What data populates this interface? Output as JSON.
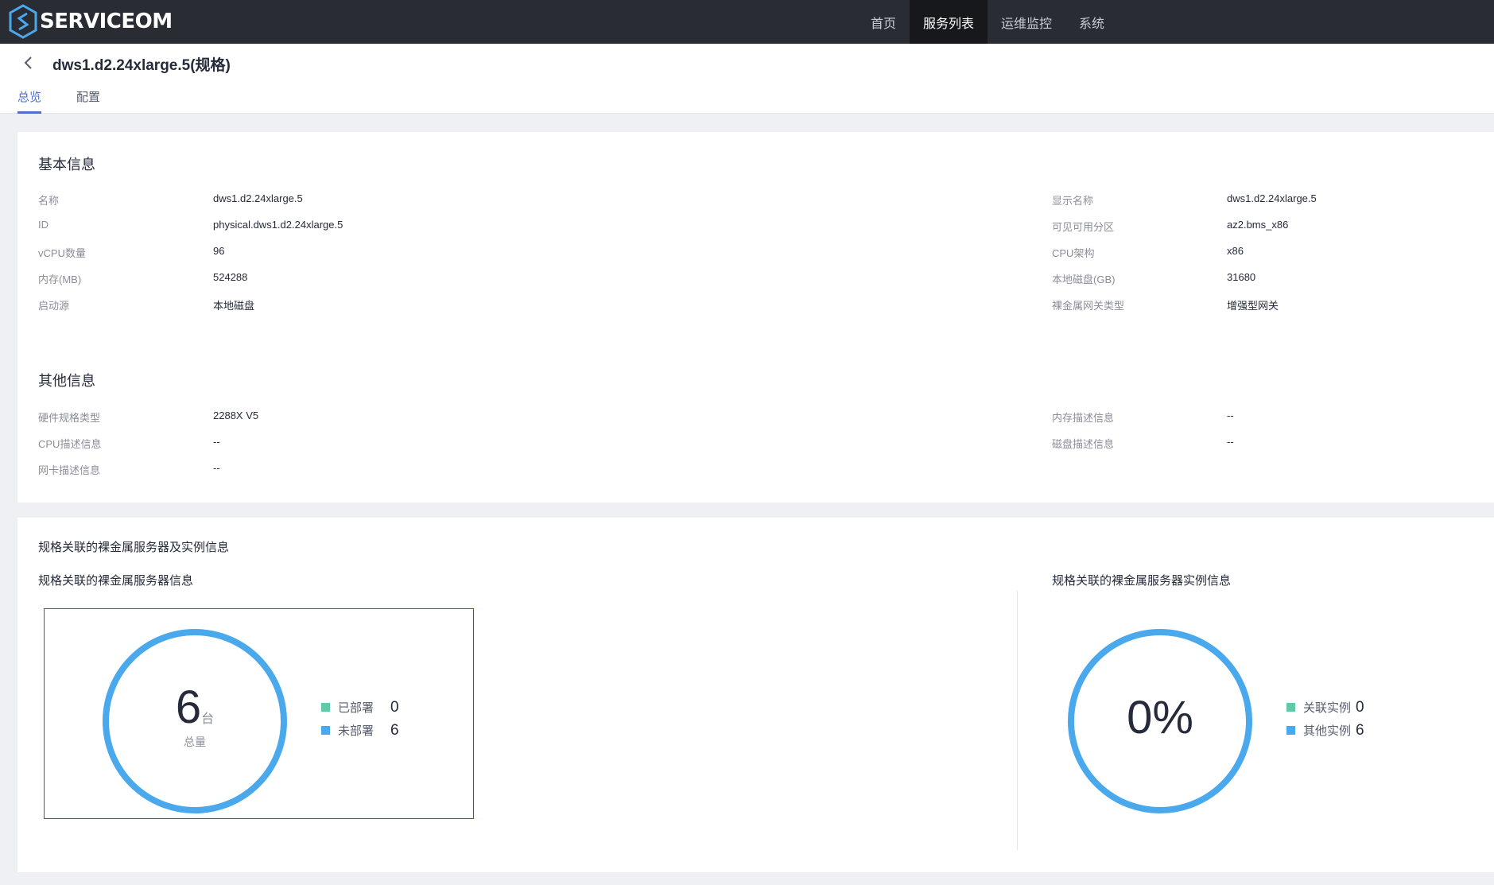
{
  "nav": {
    "logo_text": "SERVICEOM",
    "items": [
      {
        "label": "首页",
        "active": false
      },
      {
        "label": "服务列表",
        "active": true
      },
      {
        "label": "运维监控",
        "active": false
      },
      {
        "label": "系统",
        "active": false
      }
    ]
  },
  "header": {
    "title": "dws1.d2.24xlarge.5(规格)",
    "tabs": [
      {
        "label": "总览",
        "active": true
      },
      {
        "label": "配置",
        "active": false
      }
    ]
  },
  "basic_info": {
    "title": "基本信息",
    "left": [
      {
        "label": "名称",
        "value": "dws1.d2.24xlarge.5"
      },
      {
        "label": "ID",
        "value": "physical.dws1.d2.24xlarge.5"
      },
      {
        "label": "vCPU数量",
        "value": "96"
      },
      {
        "label": "内存(MB)",
        "value": "524288"
      },
      {
        "label": "启动源",
        "value": "本地磁盘"
      }
    ],
    "right": [
      {
        "label": "显示名称",
        "value": "dws1.d2.24xlarge.5"
      },
      {
        "label": "可见可用分区",
        "value": "az2.bms_x86"
      },
      {
        "label": "CPU架构",
        "value": "x86"
      },
      {
        "label": "本地磁盘(GB)",
        "value": "31680"
      },
      {
        "label": "裸金属网关类型",
        "value": "增强型网关"
      }
    ]
  },
  "other_info": {
    "title": "其他信息",
    "left": [
      {
        "label": "硬件规格类型",
        "value": "2288X V5"
      },
      {
        "label": "CPU描述信息",
        "value": "--"
      },
      {
        "label": "网卡描述信息",
        "value": "--"
      }
    ],
    "right": [
      {
        "label": "内存描述信息",
        "value": "--"
      },
      {
        "label": "磁盘描述信息",
        "value": "--"
      }
    ]
  },
  "servers_section": {
    "title": "规格关联的裸金属服务器及实例信息",
    "server_info": {
      "title": "规格关联的裸金属服务器信息",
      "total": "6",
      "unit": "台",
      "total_label": "总量",
      "legend": [
        {
          "label": "已部署",
          "value": "0",
          "color": "#5fc9a8"
        },
        {
          "label": "未部署",
          "value": "6",
          "color": "#4aa8ec"
        }
      ]
    },
    "instance_info": {
      "title": "规格关联的裸金属服务器实例信息",
      "percent": "0%",
      "legend": [
        {
          "label": "关联实例",
          "value": "0",
          "color": "#5fc9a8"
        },
        {
          "label": "其他实例",
          "value": "6",
          "color": "#4aa8ec"
        }
      ]
    }
  },
  "colors": {
    "accent": "#526ecc",
    "ring": "#4aa8ec",
    "topbar": "#292c33",
    "highlight": "#e02020"
  }
}
